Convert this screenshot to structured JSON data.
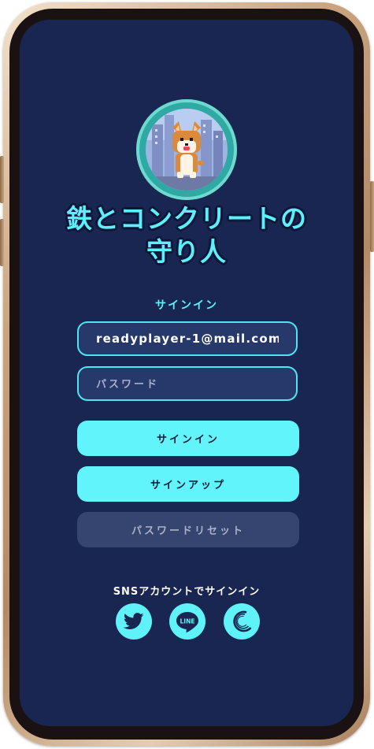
{
  "app": {
    "title_line1": "鉄とコンクリートの",
    "title_line2": "守り人"
  },
  "signin": {
    "section_label": "サインイン",
    "email_value": "readyplayer-1@mail.com",
    "password_placeholder": "パスワード",
    "signin_label": "サインイン",
    "signup_label": "サインアップ",
    "reset_label": "パスワードリセット"
  },
  "sns": {
    "label": "SNSアカウントでサインイン",
    "providers": [
      {
        "name": "twitter",
        "icon": "twitter-bird-icon"
      },
      {
        "name": "line",
        "icon": "line-logo-icon",
        "text": "LINE"
      },
      {
        "name": "other",
        "icon": "crescent-logo-icon"
      }
    ]
  },
  "colors": {
    "screen_bg": "#182651",
    "accent": "#62f4fb",
    "reset_bg": "#35456f"
  }
}
